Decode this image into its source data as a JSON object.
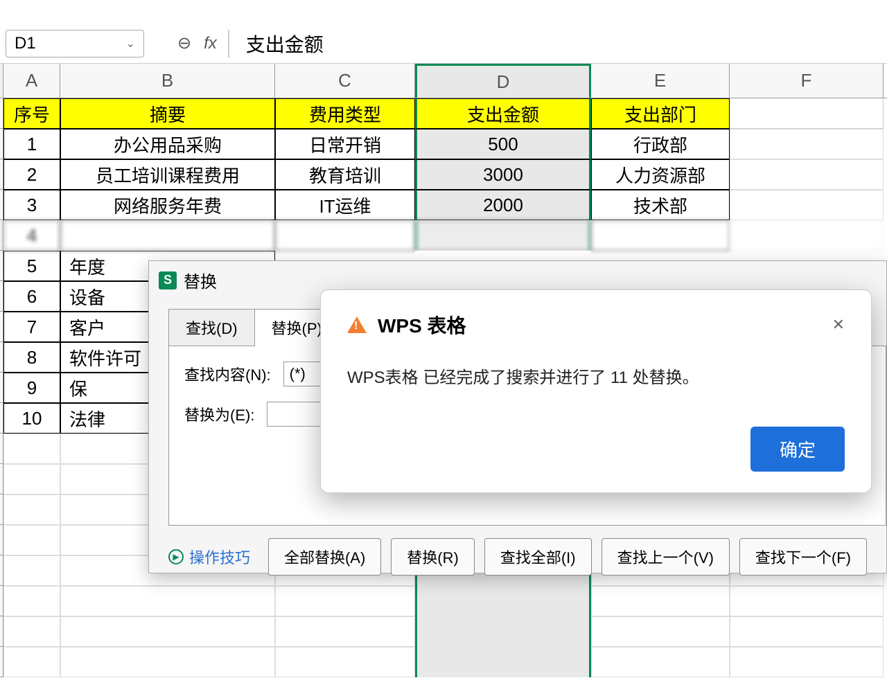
{
  "formula_bar": {
    "cell_ref": "D1",
    "fx_label": "fx",
    "value": "支出金额"
  },
  "columns": [
    "A",
    "B",
    "C",
    "D",
    "E",
    "F"
  ],
  "header_row": {
    "seq": "序号",
    "summary": "摘要",
    "type": "费用类型",
    "amount": "支出金额",
    "dept": "支出部门"
  },
  "rows": [
    {
      "seq": "1",
      "summary": "办公用品采购",
      "type": "日常开销",
      "amount": "500",
      "dept": "行政部"
    },
    {
      "seq": "2",
      "summary": "员工培训课程费用",
      "type": "教育培训",
      "amount": "3000",
      "dept": "人力资源部"
    },
    {
      "seq": "3",
      "summary": "网络服务年费",
      "type": "IT运维",
      "amount": "2000",
      "dept": "技术部"
    },
    {
      "seq": "4",
      "summary": "",
      "type": "",
      "amount": "",
      "dept": ""
    },
    {
      "seq": "5",
      "summary": "年度",
      "type": "",
      "amount": "",
      "dept": ""
    },
    {
      "seq": "6",
      "summary": "设备",
      "type": "",
      "amount": "",
      "dept": ""
    },
    {
      "seq": "7",
      "summary": "客户",
      "type": "",
      "amount": "",
      "dept": ""
    },
    {
      "seq": "8",
      "summary": "软件许可",
      "type": "",
      "amount": "",
      "dept": ""
    },
    {
      "seq": "9",
      "summary": "保",
      "type": "",
      "amount": "",
      "dept": ""
    },
    {
      "seq": "10",
      "summary": "法律",
      "type": "",
      "amount": "",
      "dept": ""
    }
  ],
  "find_replace": {
    "title": "替换",
    "tab_find": "查找(D)",
    "tab_replace": "替换(P)",
    "find_label": "查找内容(N):",
    "find_value": "(*)",
    "replace_label": "替换为(E):",
    "replace_value": "",
    "tips": "操作技巧",
    "btn_replace_all": "全部替换(A)",
    "btn_replace": "替换(R)",
    "btn_find_all": "查找全部(I)",
    "btn_find_prev": "查找上一个(V)",
    "btn_find_next": "查找下一个(F)"
  },
  "message": {
    "title": "WPS 表格",
    "body": "WPS表格 已经完成了搜索并进行了 11 处替换。",
    "ok": "确定"
  }
}
